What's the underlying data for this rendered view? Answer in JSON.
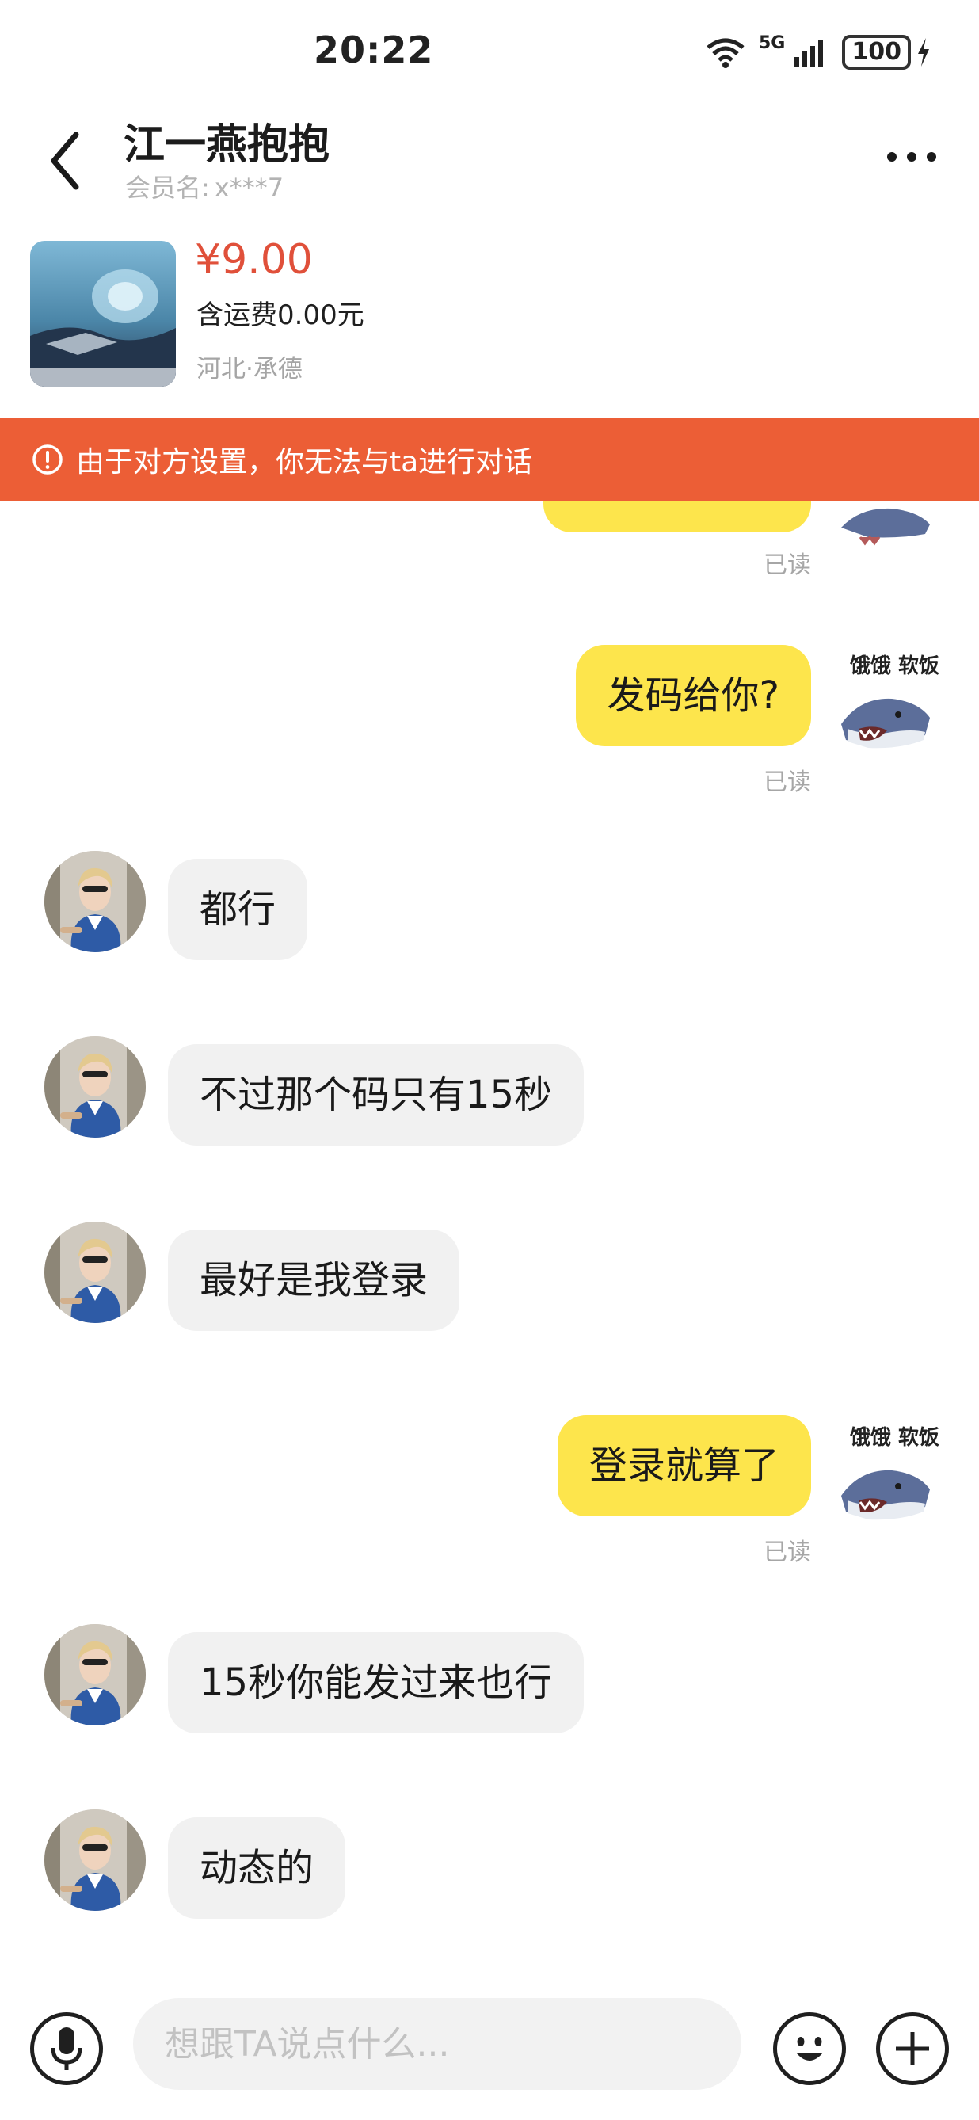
{
  "status_bar": {
    "time": "20:22",
    "network": "5G",
    "battery": "100"
  },
  "header": {
    "title": "江一燕抱抱",
    "member_label": "会员名:",
    "member_value": "x***7"
  },
  "product": {
    "price": "¥9.00",
    "shipping": "含运费0.00元",
    "location": "河北·承德"
  },
  "banner": {
    "text": "由于对方设置，你无法与ta进行对话"
  },
  "my_avatar_caption": "饿饿 软饭",
  "messages": [
    {
      "side": "me",
      "text": "",
      "read": "已读"
    },
    {
      "side": "me",
      "text": "发码给你?",
      "read": "已读"
    },
    {
      "side": "them",
      "text": "都行"
    },
    {
      "side": "them",
      "text": "不过那个码只有15秒"
    },
    {
      "side": "them",
      "text": "最好是我登录"
    },
    {
      "side": "me",
      "text": "登录就算了",
      "read": "已读"
    },
    {
      "side": "them",
      "text": "15秒你能发过来也行"
    },
    {
      "side": "them",
      "text": "动态的"
    }
  ],
  "input": {
    "placeholder": "想跟TA说点什么..."
  },
  "icons": {
    "back": "chevron-left-icon",
    "more": "more-dots-icon",
    "warning": "warning-circle-icon",
    "voice": "microphone-icon",
    "emoji": "emoji-icon",
    "plus": "plus-icon"
  },
  "colors": {
    "banner": "#ec5e36",
    "my_bubble": "#fde54c",
    "their_bubble": "#f1f1f1",
    "price": "#e0503a"
  }
}
